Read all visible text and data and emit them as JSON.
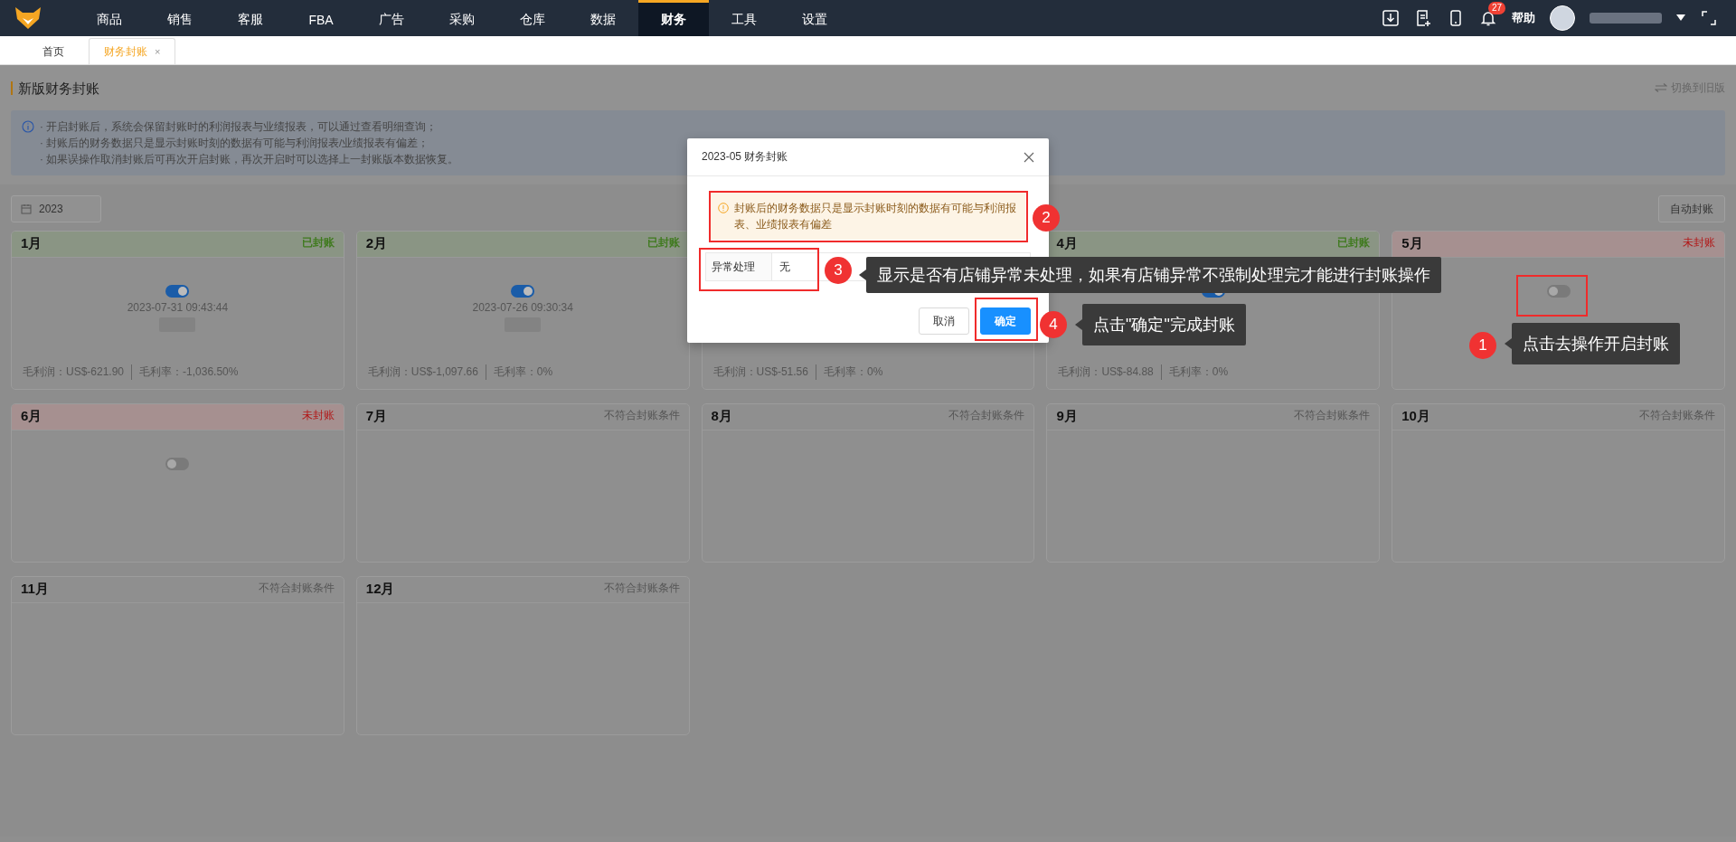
{
  "nav": {
    "items": [
      {
        "label": "商品",
        "selected": false
      },
      {
        "label": "销售",
        "selected": false
      },
      {
        "label": "客服",
        "selected": false
      },
      {
        "label": "FBA",
        "selected": false
      },
      {
        "label": "广告",
        "selected": false
      },
      {
        "label": "采购",
        "selected": false
      },
      {
        "label": "仓库",
        "selected": false
      },
      {
        "label": "数据",
        "selected": false
      },
      {
        "label": "财务",
        "selected": true
      },
      {
        "label": "工具",
        "selected": false
      },
      {
        "label": "设置",
        "selected": false
      }
    ],
    "badge": "27",
    "help": "帮助"
  },
  "tabs": [
    {
      "label": "首页",
      "selected": false
    },
    {
      "label": "财务封账",
      "selected": true,
      "close": "×"
    }
  ],
  "page": {
    "title": "新版财务封账",
    "switch_link": "切换到旧版"
  },
  "notice": {
    "lines": [
      "· 开启封账后，系统会保留封账时的利润报表与业绩报表，可以通过查看明细查询；",
      "· 封账后的财务数据只是显示封账时刻的数据有可能与利润报表/业绩报表有偏差；",
      "· 如果误操作取消封账后可再次开启封账，再次开启时可以选择上一封账版本数据恢复。"
    ]
  },
  "toolbar": {
    "year": "2023",
    "auto_button": "自动封账"
  },
  "cards": [
    {
      "month": "1月",
      "kind": "sealed",
      "status": "已封账",
      "toggle_on": true,
      "timestamp": "2023-07-31 09:43:44",
      "operator_blurred": true,
      "footer": {
        "profit": "毛利润：US$-621.90",
        "rate": "毛利率：-1,036.50%"
      }
    },
    {
      "month": "2月",
      "kind": "sealed",
      "status": "已封账",
      "toggle_on": true,
      "timestamp": "2023-07-26 09:30:34",
      "operator_blurred": true,
      "footer": {
        "profit": "毛利润：US$-1,097.66",
        "rate": "毛利率：0%"
      }
    },
    {
      "footer": {
        "profit": "毛利润：US$-51.56",
        "rate": "毛利率：0%"
      }
    },
    {
      "month": "4月",
      "kind": "sealed",
      "status": "已封账",
      "toggle_on": true,
      "footer": {
        "profit": "毛利润：US$-84.88",
        "rate": "毛利率：0%"
      }
    },
    {
      "month": "5月",
      "kind": "unsealed",
      "status": "未封账",
      "toggle_on": false
    },
    {
      "month": "6月",
      "kind": "unsealed",
      "status": "未封账",
      "toggle_on": false
    },
    {
      "month": "7月",
      "kind": "ineligible",
      "status": "不符合封账条件"
    },
    {
      "month": "8月",
      "kind": "ineligible",
      "status": "不符合封账条件"
    },
    {
      "month": "9月",
      "kind": "ineligible",
      "status": "不符合封账条件"
    },
    {
      "month": "10月",
      "kind": "ineligible",
      "status": "不符合封账条件"
    },
    {
      "month": "11月",
      "kind": "ineligible",
      "status": "不符合封账条件"
    },
    {
      "month": "12月",
      "kind": "ineligible",
      "status": "不符合封账条件"
    }
  ],
  "dialog": {
    "title": "2023-05 财务封账",
    "alert": "封账后的财务数据只是显示封账时刻的数据有可能与利润报表、业绩报表有偏差",
    "table": {
      "label": "异常处理",
      "value": "无"
    },
    "buttons": [
      {
        "label": "取消",
        "kind": "default"
      },
      {
        "label": "确定",
        "kind": "primary"
      }
    ]
  },
  "annotations": [
    {
      "number": "1",
      "text": "点击去操作开启封账"
    },
    {
      "number": "2"
    },
    {
      "number": "3",
      "text": "显示是否有店铺异常未处理，如果有店铺异常不强制处理完才能进行封账操作"
    },
    {
      "number": "4",
      "text": "点击\"确定\"完成封账"
    }
  ]
}
